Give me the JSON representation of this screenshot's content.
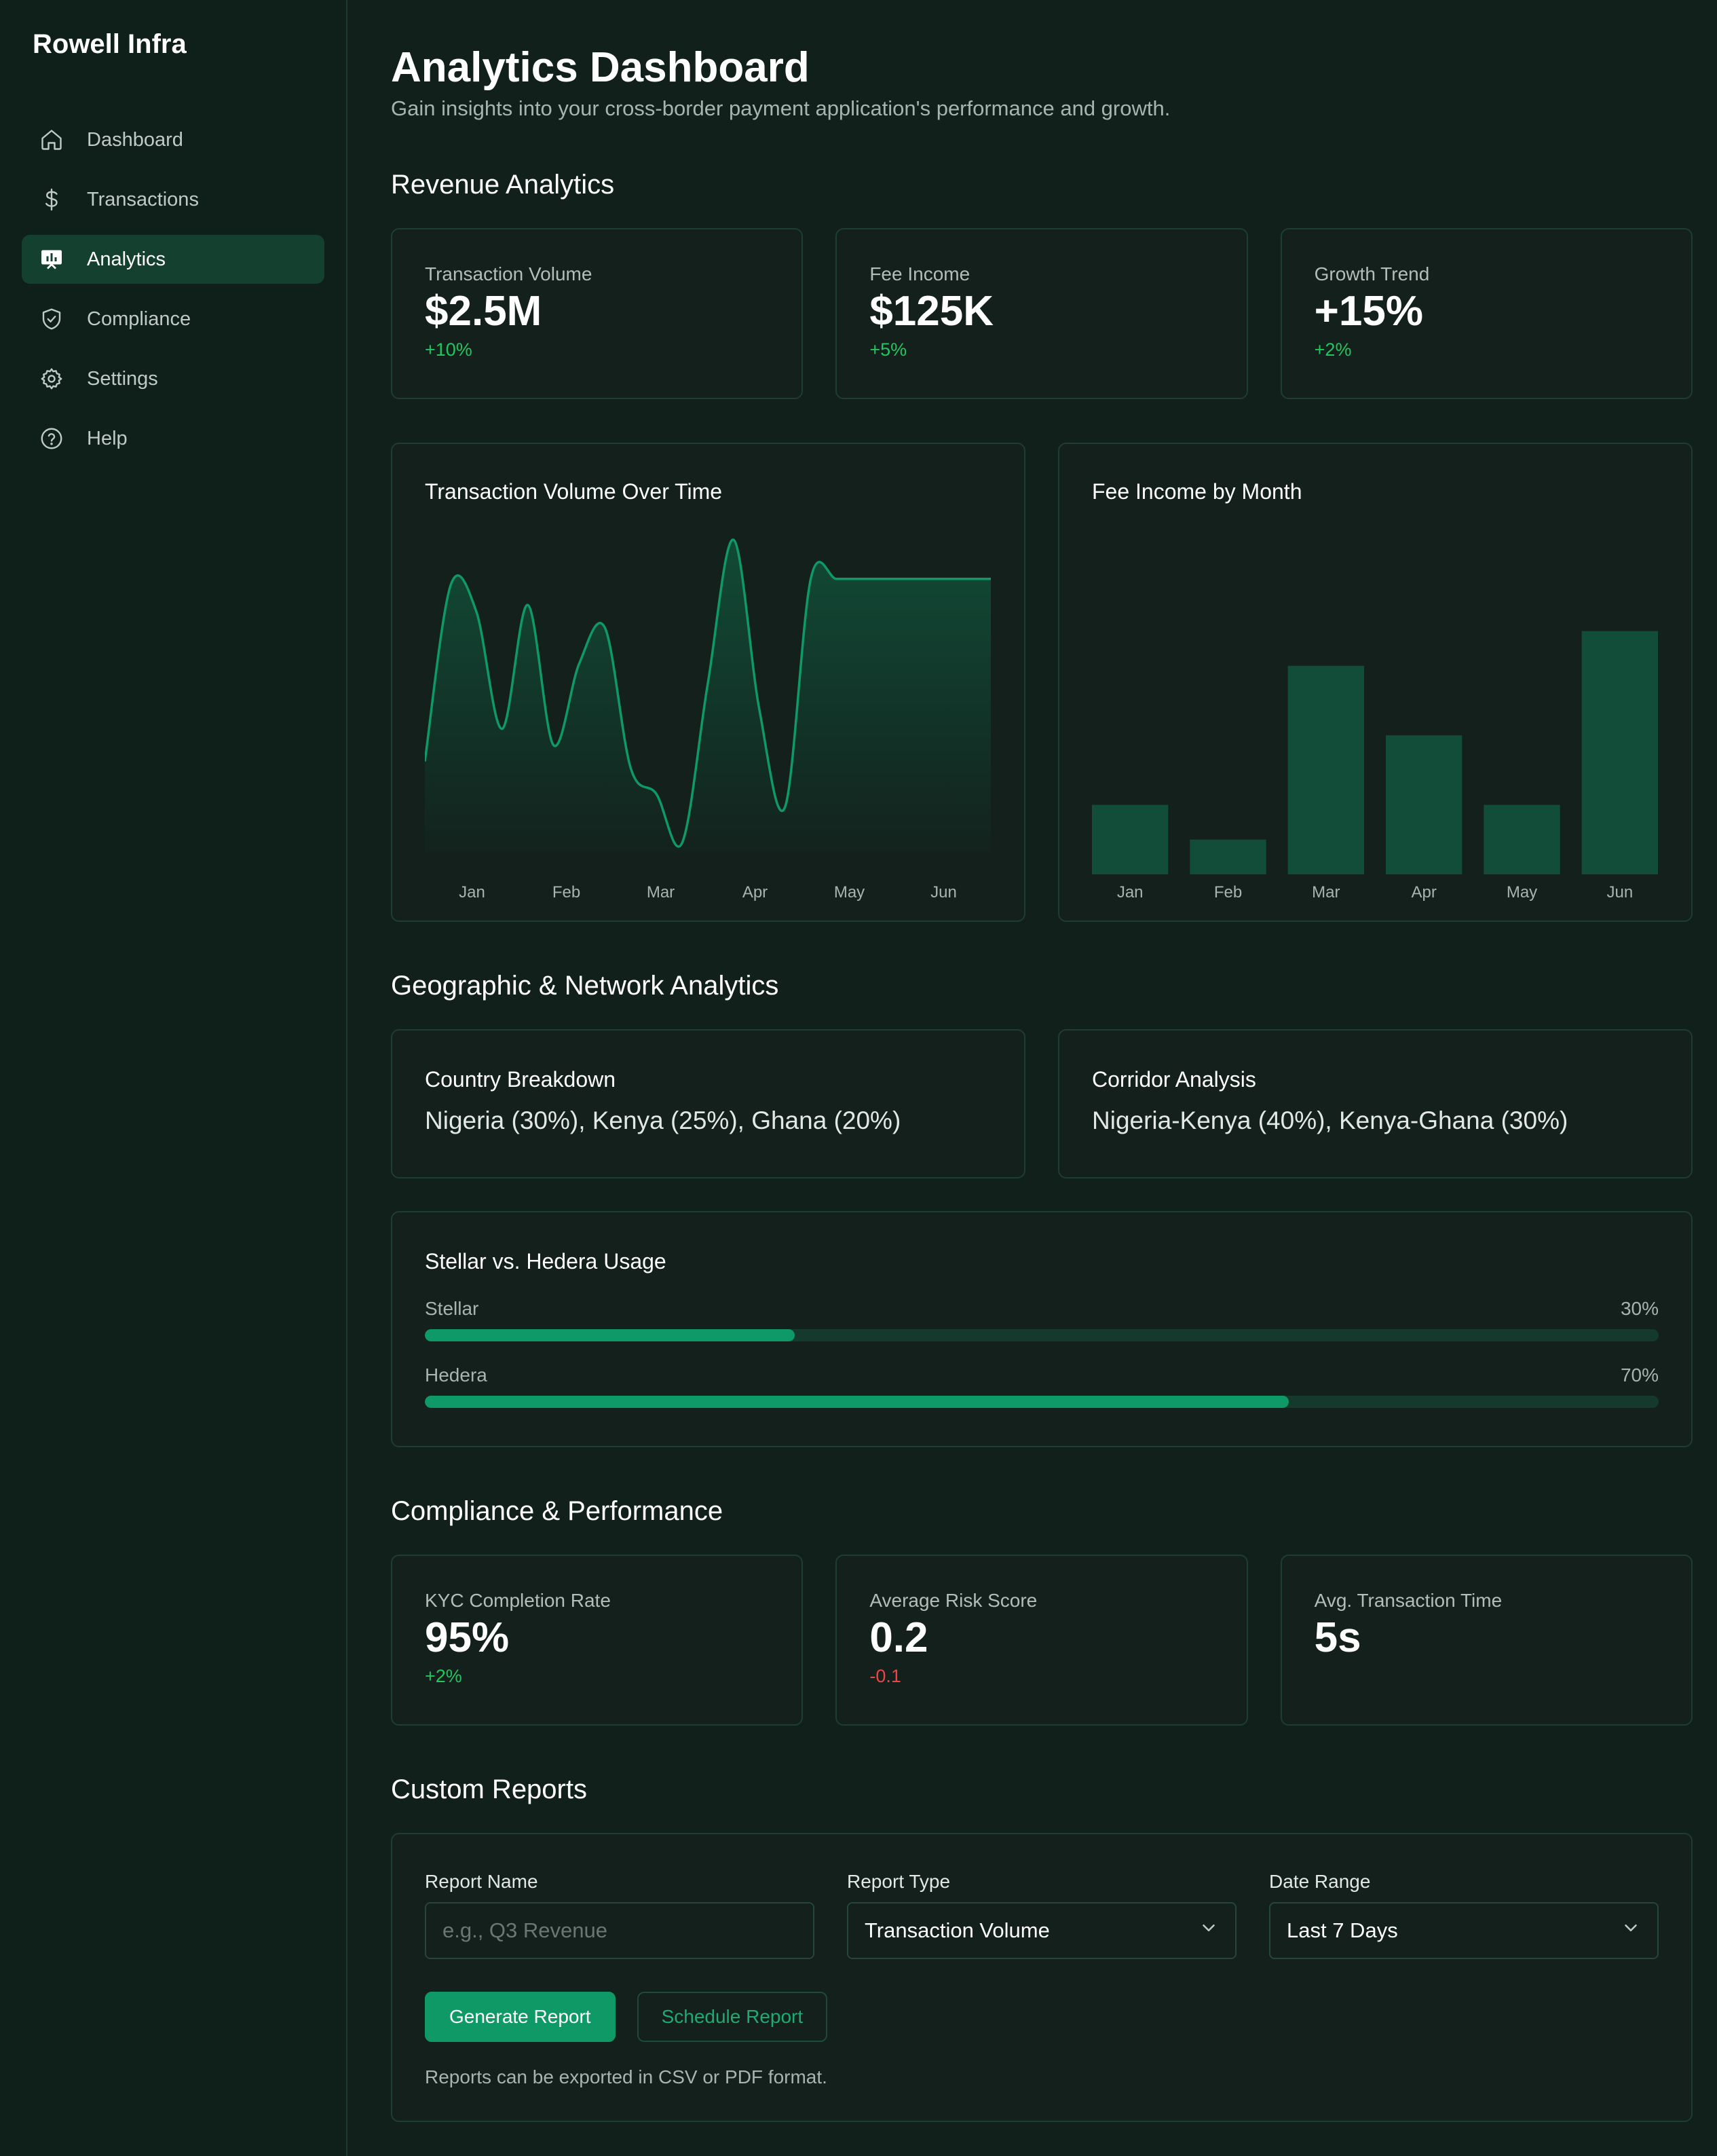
{
  "brand": "Rowell Infra",
  "nav": [
    {
      "label": "Dashboard",
      "icon": "home-icon"
    },
    {
      "label": "Transactions",
      "icon": "dollar-icon"
    },
    {
      "label": "Analytics",
      "icon": "analytics-icon",
      "active": true
    },
    {
      "label": "Compliance",
      "icon": "shield-icon"
    },
    {
      "label": "Settings",
      "icon": "gear-icon"
    },
    {
      "label": "Help",
      "icon": "help-icon"
    }
  ],
  "header": {
    "title": "Analytics Dashboard",
    "subtitle": "Gain insights into your cross-border payment application's performance and growth."
  },
  "revenue": {
    "title": "Revenue Analytics",
    "stats": [
      {
        "label": "Transaction Volume",
        "value": "$2.5M",
        "change": "+10%"
      },
      {
        "label": "Fee Income",
        "value": "$125K",
        "change": "+5%"
      },
      {
        "label": "Growth Trend",
        "value": "+15%",
        "change": "+2%"
      }
    ]
  },
  "charts": {
    "volume_title": "Transaction Volume Over Time",
    "fee_title": "Fee Income by Month"
  },
  "chart_data": [
    {
      "type": "area",
      "title": "Transaction Volume Over Time",
      "categories": [
        "Jan",
        "Feb",
        "Mar",
        "Apr",
        "May",
        "Jun"
      ],
      "x": [
        0,
        0.25,
        0.5,
        0.75,
        1,
        1.25,
        1.5,
        1.75,
        2,
        2.25,
        2.5,
        2.75,
        3,
        3.25,
        3.5,
        3.75,
        4,
        4.25,
        4.5,
        4.75,
        5,
        5.25,
        5.5
      ],
      "values": [
        28,
        82,
        74,
        38,
        76,
        33,
        58,
        69,
        26,
        18,
        3,
        52,
        96,
        44,
        14,
        84,
        84,
        84,
        84,
        84,
        84,
        84,
        84
      ],
      "ylim": [
        0,
        100
      ],
      "color": "#0e9966"
    },
    {
      "type": "bar",
      "title": "Fee Income by Month",
      "categories": [
        "Jan",
        "Feb",
        "Mar",
        "Apr",
        "May",
        "Jun"
      ],
      "values": [
        20,
        10,
        60,
        40,
        20,
        70
      ],
      "ylim": [
        0,
        100
      ],
      "color": "#114d38"
    }
  ],
  "geo": {
    "title": "Geographic & Network Analytics",
    "country": {
      "label": "Country Breakdown",
      "value": "Nigeria (30%), Kenya (25%), Ghana (20%)"
    },
    "corridor": {
      "label": "Corridor Analysis",
      "value": "Nigeria-Kenya (40%), Kenya-Ghana (30%)"
    },
    "usage": {
      "title": "Stellar vs. Hedera Usage",
      "items": [
        {
          "label": "Stellar",
          "percent_label": "30%",
          "percent": 30
        },
        {
          "label": "Hedera",
          "percent_label": "70%",
          "percent": 70
        }
      ]
    }
  },
  "compliance": {
    "title": "Compliance & Performance",
    "stats": [
      {
        "label": "KYC Completion Rate",
        "value": "95%",
        "change": "+2%"
      },
      {
        "label": "Average Risk Score",
        "value": "0.2",
        "change": "-0.1"
      },
      {
        "label": "Avg. Transaction Time",
        "value": "5s",
        "change": ""
      }
    ]
  },
  "reports": {
    "title": "Custom Reports",
    "name_label": "Report Name",
    "name_placeholder": "e.g., Q3 Revenue",
    "type_label": "Report Type",
    "type_value": "Transaction Volume",
    "range_label": "Date Range",
    "range_value": "Last 7 Days",
    "generate_label": "Generate Report",
    "schedule_label": "Schedule Report",
    "note": "Reports can be exported in CSV or PDF format."
  }
}
